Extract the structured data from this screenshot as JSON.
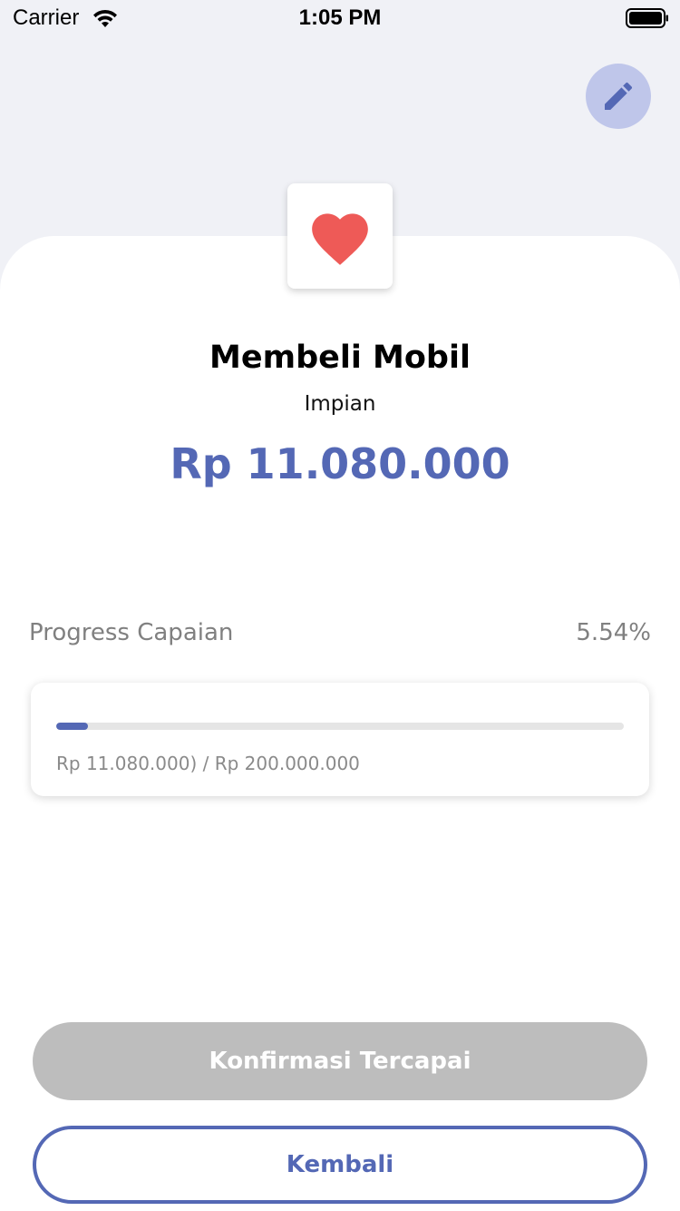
{
  "status_bar": {
    "carrier": "Carrier",
    "time": "1:05 PM",
    "icons": [
      "wifi-icon",
      "battery-icon"
    ]
  },
  "header": {
    "edit_icon": "pencil-icon",
    "edit_button_color": "#bfc6ea"
  },
  "goal": {
    "icon": "heart-icon",
    "icon_color": "#ee5a57",
    "title": "Membeli Mobil",
    "category": "Impian",
    "amount": "Rp 11.080.000",
    "amount_color": "#5468b5"
  },
  "progress": {
    "label": "Progress Capaian",
    "percent_text": "5.54%",
    "fraction": 0.0554,
    "detail": "Rp 11.080.000) / Rp 200.000.000"
  },
  "actions": {
    "confirm_label": "Konfirmasi Tercapai",
    "back_label": "Kembali"
  },
  "colors": {
    "accent": "#5468b5",
    "background": "#f0f1f6",
    "disabled": "#bdbdbd"
  }
}
